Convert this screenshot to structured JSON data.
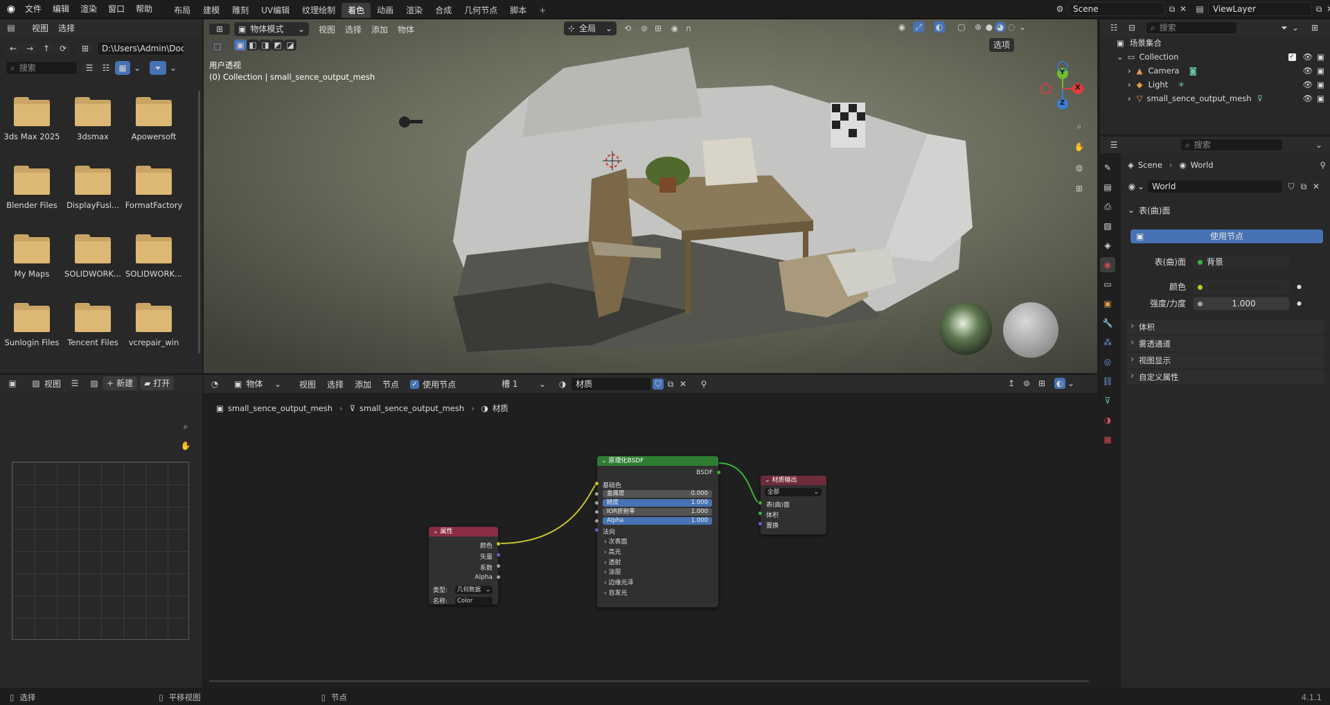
{
  "menu": {
    "file": "文件",
    "edit": "编辑",
    "render": "渲染",
    "window": "窗口",
    "help": "帮助"
  },
  "workspaces": [
    "布局",
    "建模",
    "雕刻",
    "UV编辑",
    "纹理绘制",
    "着色",
    "动画",
    "渲染",
    "合成",
    "几何节点",
    "脚本"
  ],
  "active_workspace": "着色",
  "scene": {
    "name": "Scene",
    "view_layer": "ViewLayer"
  },
  "file_browser": {
    "view": "视图",
    "select": "选择",
    "path": "D:\\Users\\Admin\\Doc...",
    "search_placeholder": "搜索",
    "folders": [
      "3ds Max 2025",
      "3dsmax",
      "Apowersoft",
      "Blender Files",
      "DisplayFusi...",
      "FormatFactory",
      "My Maps",
      "SOLIDWORK...",
      "SOLIDWORK...",
      "Sunlogin Files",
      "Tencent Files",
      "vcrepair_win"
    ]
  },
  "viewport": {
    "mode": "物体模式",
    "view": "视图",
    "select": "选择",
    "add": "添加",
    "object": "物体",
    "transform": "全局",
    "options": "选项",
    "overlay_title": "用户透视",
    "overlay_sub": "(0) Collection | small_sence_output_mesh",
    "gizmo": {
      "x": "X",
      "y": "Y",
      "z": "Z"
    }
  },
  "image_editor": {
    "view": "视图",
    "new": "新建",
    "open": "打开"
  },
  "node_editor": {
    "mode": "物体",
    "view": "视图",
    "select": "选择",
    "add": "添加",
    "node": "节点",
    "use_nodes": "使用节点",
    "slot": "槽 1",
    "material": "材质",
    "breadcrumb": [
      "small_sence_output_mesh",
      "small_sence_output_mesh",
      "材质"
    ],
    "attr_node": {
      "title": "属性",
      "outputs": [
        "颜色",
        "矢量",
        "系数",
        "Alpha"
      ],
      "type_label": "类型:",
      "type_value": "几何数据",
      "name_label": "名称:",
      "name_value": "Color"
    },
    "bsdf_node": {
      "title": "原理化BSDF",
      "output": "BSDF",
      "base_color": "基础色",
      "sliders": [
        {
          "label": "金属度",
          "value": "0.000",
          "blue": false
        },
        {
          "label": "糙度",
          "value": "1.000",
          "blue": true
        },
        {
          "label": "IOR折射率",
          "value": "1.000",
          "blue": false
        },
        {
          "label": "Alpha",
          "value": "1.000",
          "blue": true
        }
      ],
      "normal": "法向",
      "panels": [
        "次表面",
        "高光",
        "透射",
        "涂层",
        "边缘光泽",
        "自发光"
      ]
    },
    "output_node": {
      "title": "材质输出",
      "target": "全部",
      "inputs": [
        "表(曲)面",
        "体积",
        "置换"
      ]
    }
  },
  "outliner": {
    "search_placeholder": "搜索",
    "root": "场景集合",
    "collection": "Collection",
    "items": [
      "Camera",
      "Light",
      "small_sence_output_mesh"
    ]
  },
  "properties": {
    "search_placeholder": "搜索",
    "breadcrumb": [
      "Scene",
      "World"
    ],
    "world_name": "World",
    "surface_panel": "表(曲)面",
    "use_nodes": "使用节点",
    "surface_label": "表(曲)面",
    "surface_value": "背景",
    "color_label": "颜色",
    "strength_label": "强度/力度",
    "strength_value": "1.000",
    "panels": [
      "体积",
      "雾透通道",
      "视图显示",
      "自定义属性"
    ]
  },
  "status": {
    "select": "选择",
    "pan": "平移视图",
    "node": "节点",
    "version": "4.1.1"
  },
  "colors": {
    "accent": "#4772b3",
    "active_btn": "#3d6fb5",
    "attr_head": "#8a2d42",
    "bsdf_head": "#2e7d32",
    "output_head": "#6e2b3a",
    "link_yellow": "#c8c82e",
    "link_green": "#3cb43c"
  }
}
